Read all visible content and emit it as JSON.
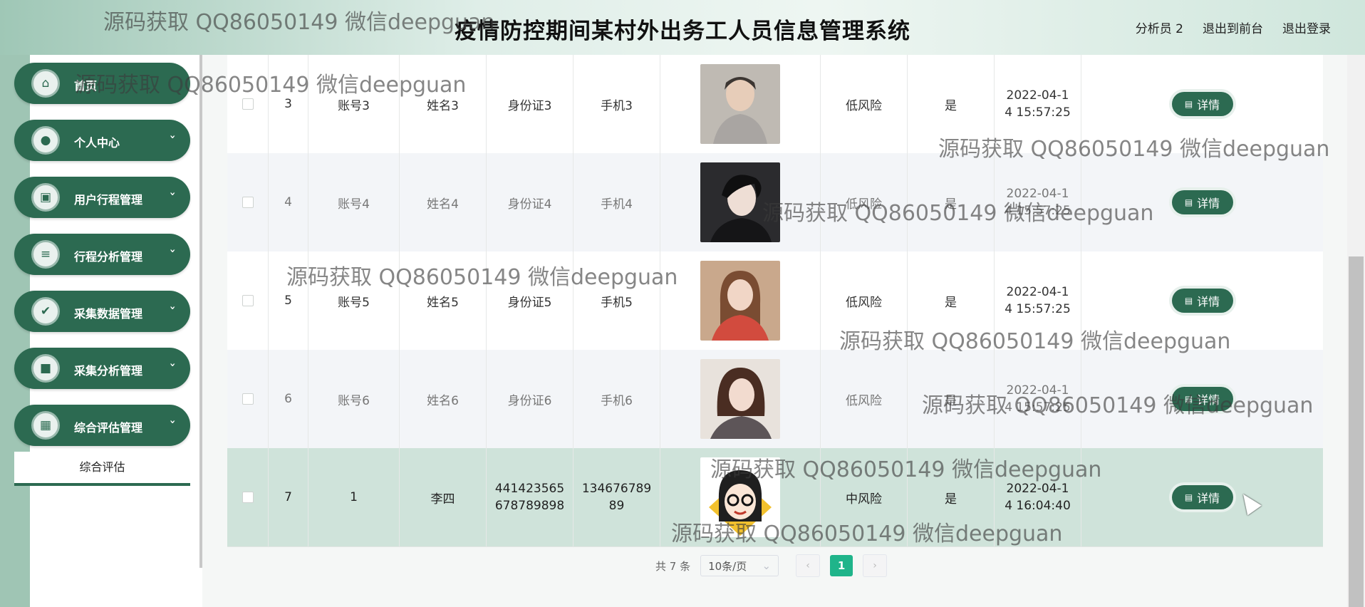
{
  "header": {
    "title": "疫情防控期间某村外出务工人员信息管理系统",
    "user": "分析员 2",
    "front": "退出到前台",
    "logout": "退出登录"
  },
  "sidebar": {
    "items": [
      {
        "label": "首页",
        "icon": "home-icon"
      },
      {
        "label": "个人中心",
        "icon": "person-icon"
      },
      {
        "label": "用户行程管理",
        "icon": "clipboard-icon"
      },
      {
        "label": "行程分析管理",
        "icon": "sliders-icon"
      },
      {
        "label": "采集数据管理",
        "icon": "clipboard-check-icon"
      },
      {
        "label": "采集分析管理",
        "icon": "briefcase-icon"
      },
      {
        "label": "综合评估管理",
        "icon": "grid-icon"
      }
    ],
    "sub_item": "综合评估"
  },
  "table": {
    "rows": [
      {
        "no": "3",
        "account": "账号3",
        "name": "姓名3",
        "idcard": "身份证3",
        "phone": "手机3",
        "risk": "低风险",
        "flag": "是",
        "time1": "2022-04-1",
        "time2": "4 15:57:25",
        "btn": "详情"
      },
      {
        "no": "4",
        "account": "账号4",
        "name": "姓名4",
        "idcard": "身份证4",
        "phone": "手机4",
        "risk": "低风险",
        "flag": "是",
        "time1": "2022-04-1",
        "time2": "4 15:57:25",
        "btn": "详情"
      },
      {
        "no": "5",
        "account": "账号5",
        "name": "姓名5",
        "idcard": "身份证5",
        "phone": "手机5",
        "risk": "低风险",
        "flag": "是",
        "time1": "2022-04-1",
        "time2": "4 15:57:25",
        "btn": "详情"
      },
      {
        "no": "6",
        "account": "账号6",
        "name": "姓名6",
        "idcard": "身份证6",
        "phone": "手机6",
        "risk": "低风险",
        "flag": "是",
        "time1": "2022-04-1",
        "time2": "4 15:57:25",
        "btn": "详情"
      },
      {
        "no": "7",
        "account": "1",
        "name": "李四",
        "idcard1": "441423565",
        "idcard2": "678789898",
        "phone1": "134676789",
        "phone2": "89",
        "risk": "中风险",
        "flag": "是",
        "time1": "2022-04-1",
        "time2": "4 16:04:40",
        "btn": "详情"
      }
    ]
  },
  "pagination": {
    "total": "共 7 条",
    "page_size": "10条/页",
    "current": "1"
  },
  "watermark": "源码获取 QQ86050149 微信deepguan",
  "colors": {
    "primary": "#2c6a51",
    "accent": "#1fb48a"
  }
}
